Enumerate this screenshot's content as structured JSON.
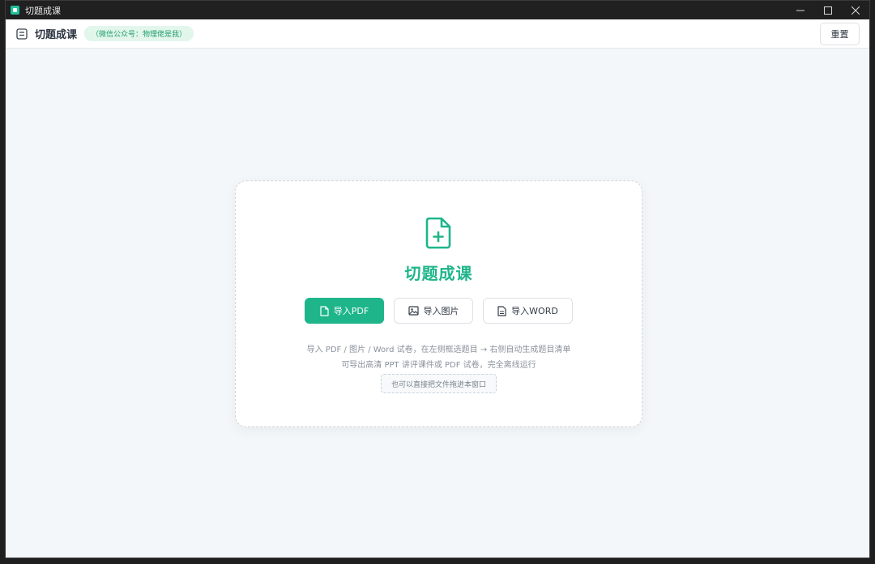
{
  "window": {
    "title": "切题成课"
  },
  "header": {
    "app_name": "切题成课",
    "badge": "（微信公众号：物理佬是我）",
    "reset_label": "重置"
  },
  "card": {
    "title": "切题成课",
    "buttons": {
      "import_pdf": "导入PDF",
      "import_image": "导入图片",
      "import_word": "导入WORD"
    },
    "desc_line1": "导入 PDF / 图片 / Word 试卷，在左侧框选题目 → 右侧自动生成题目清单",
    "desc_line2": "可导出高清 PPT 讲评课件或 PDF 试卷，完全离线运行",
    "drop_hint": "也可以直接把文件拖进本窗口"
  },
  "colors": {
    "accent": "#1fb58a",
    "badge_bg": "#e3f6ec",
    "badge_text": "#1f9e6e"
  },
  "icons": {
    "app": "app-logo-icon",
    "menu": "panel-icon",
    "file_add": "file-plus-icon",
    "pdf": "file-icon",
    "image": "image-icon",
    "word": "document-icon"
  }
}
